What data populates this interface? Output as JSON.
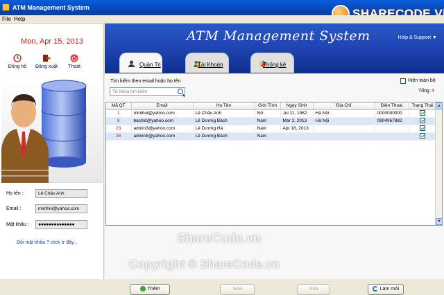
{
  "window": {
    "title": "ATM Management System"
  },
  "brand_logo": "SHARECODE.VN",
  "menu": {
    "file": "File",
    "help": "Help"
  },
  "sidebar": {
    "date": "Mon, Apr 15, 2013",
    "buttons": [
      {
        "label": "Đồng hồ",
        "icon": "clock-icon"
      },
      {
        "label": "Đăng xuất",
        "icon": "logout-icon"
      },
      {
        "label": "Thoát",
        "icon": "power-icon"
      }
    ],
    "fields": {
      "name_label": "Họ tên :",
      "name_value": "Lê Châu Anh",
      "email_label": "Email :",
      "email_value": "minthoi@yahoo.com",
      "password_label": "Mật khẩu :",
      "password_value": "●●●●●●●●●●●●●●"
    },
    "change_password_link": "Đổi mật khẩu ? click ở đây..."
  },
  "banner": {
    "title": "ATM Management System",
    "help_support": "Help & Support ▼"
  },
  "tabs": [
    {
      "label": "Quản Trị",
      "icon": "admin-user-icon",
      "active": true
    },
    {
      "label": "Tài Khoản",
      "icon": "accounts-icon",
      "active": false
    },
    {
      "label": "Thống kê",
      "icon": "chart-icon",
      "active": false
    }
  ],
  "search": {
    "label": "Tìm kiếm theo email hoặc họ tên",
    "placeholder": "Từ khóa tìm kiếm"
  },
  "show_all_label": "Hiện toàn bộ",
  "total": {
    "label": "Tổng",
    "value": "4"
  },
  "table": {
    "columns": [
      "Mã QT",
      "Email",
      "Họ Tên",
      "Giới Tính",
      "Ngày Sinh",
      "Địa Chỉ",
      "Điện Thoại",
      "Trạng Thái"
    ],
    "rows": [
      {
        "id": "1",
        "email": "minthoi@yahoo.com",
        "name": "Lê Châu Anh",
        "gender": "Nữ",
        "dob": "Jul 11, 1982",
        "address": "Hà Nội",
        "phone": "0000000000",
        "status": true
      },
      {
        "id": "8",
        "email": "bachld@yahoo.com",
        "name": "Lê Dương Bách",
        "gender": "Nam",
        "dob": "Mar 3, 2013",
        "address": "Hà Nội",
        "phone": "0904967882",
        "status": true
      },
      {
        "id": "23",
        "email": "admin3@yahoo.com",
        "name": "Lê Dương Hà",
        "gender": "Nam",
        "dob": "Apr 18, 2013",
        "address": "",
        "phone": "",
        "status": true
      },
      {
        "id": "28",
        "email": "admin5@yahoo.com",
        "name": "Lê Dương Bách",
        "gender": "Nam",
        "dob": "",
        "address": "",
        "phone": "",
        "status": true
      }
    ]
  },
  "buttons": {
    "add": "Thêm",
    "edit": "Sửa",
    "delete": "Xóa",
    "refresh": "Làm mới"
  },
  "watermarks": [
    "ShareCode.vn",
    "Copyright © ShareCode.vn"
  ]
}
